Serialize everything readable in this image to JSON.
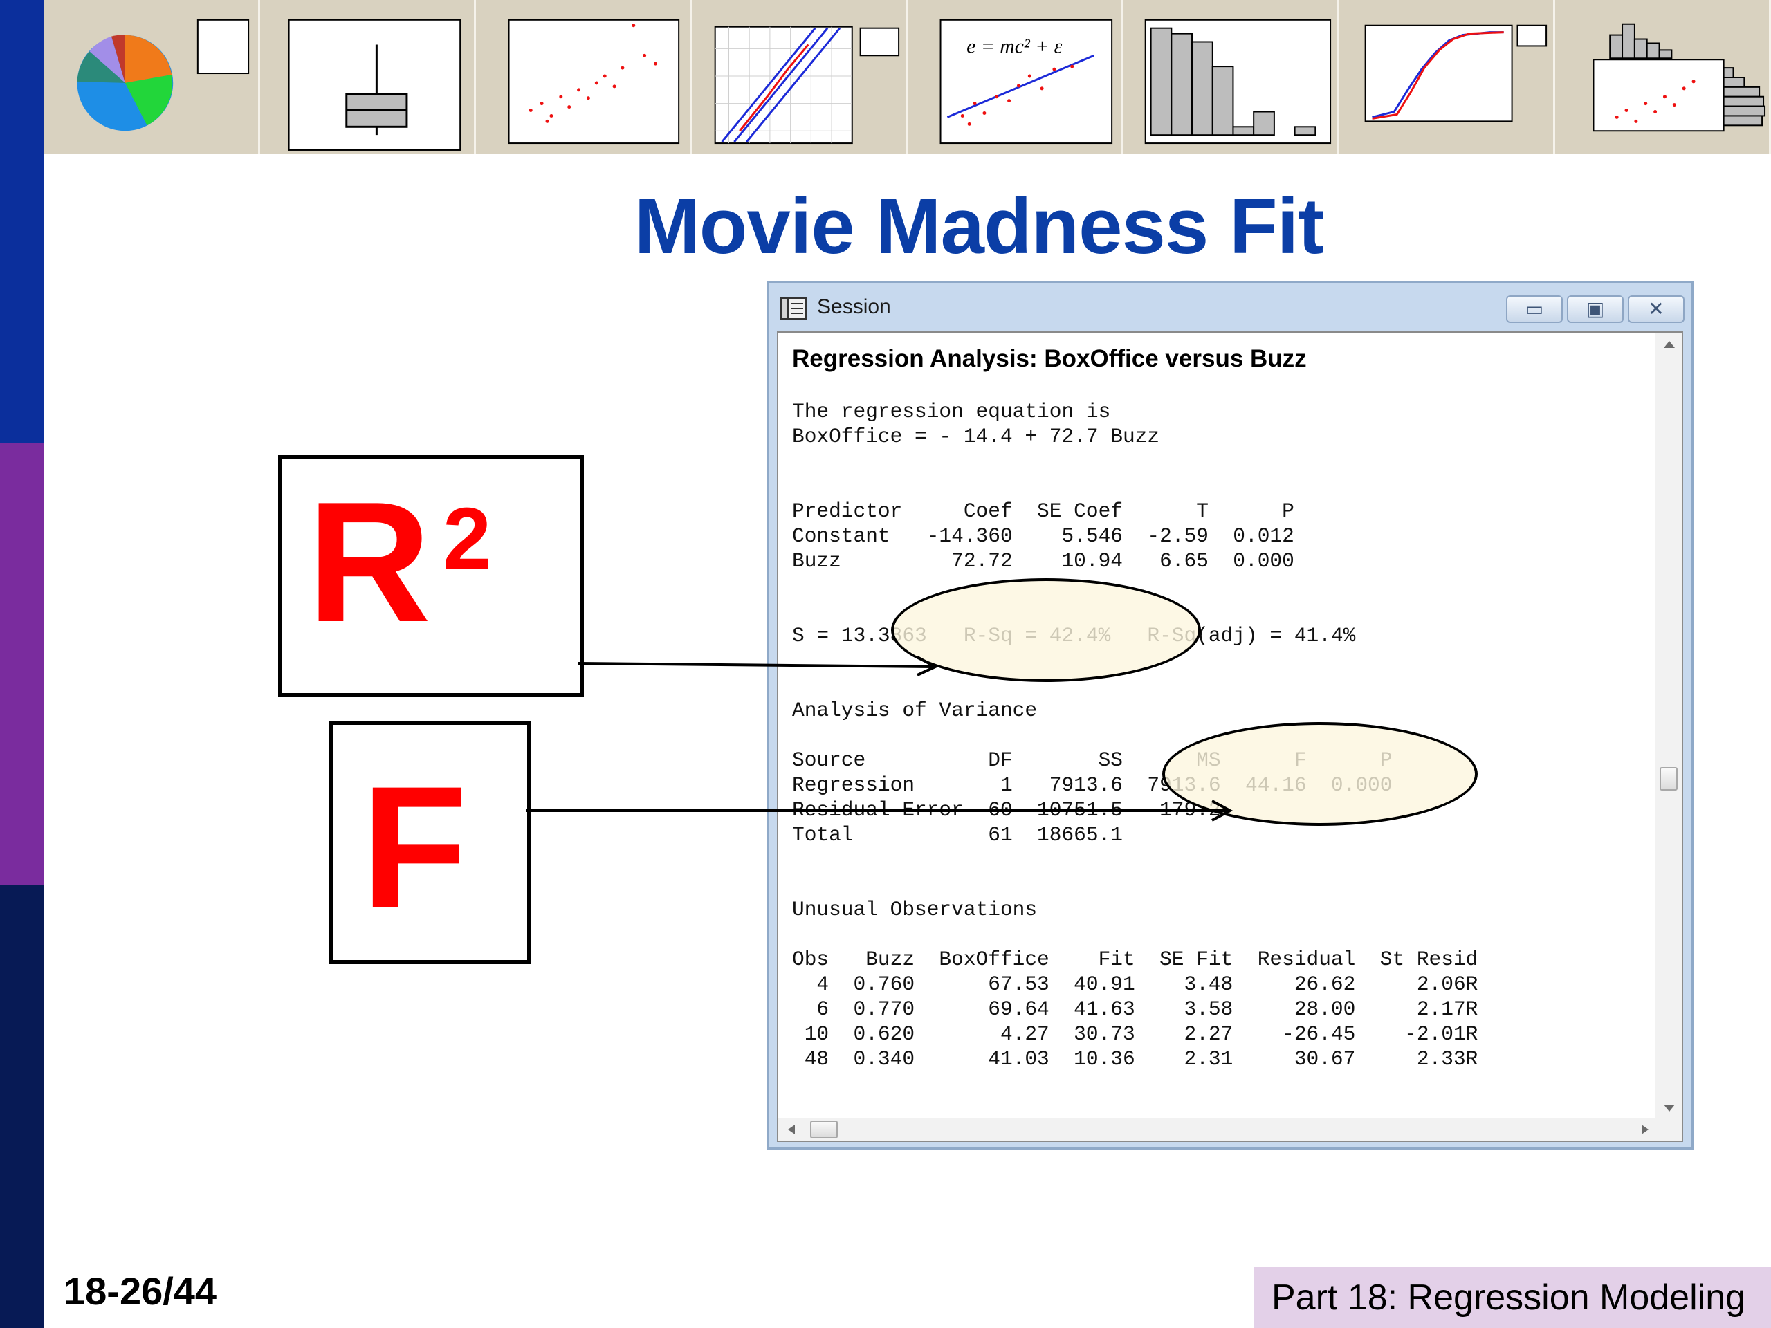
{
  "slide": {
    "title": "Movie Madness Fit",
    "slide_number": "18-26/44",
    "footer": "Part 18: Regression Modeling",
    "r_squared_label": "R",
    "r_squared_sup": "2",
    "f_label": "F",
    "colors": {
      "title": "#0b3ea6",
      "label_red": "#ff0000",
      "sidebar_top": "#0b2f9c",
      "sidebar_mid": "#7a2c9e",
      "sidebar_bottom": "#071a55",
      "footer_bg": "#e3d0e8",
      "highlight": "#fdf6de"
    }
  },
  "window": {
    "title": "Session",
    "icon": "session-icon",
    "buttons": [
      "minimize-icon",
      "maximize-icon",
      "close-icon"
    ],
    "minimize_glyph": "▭",
    "maximize_glyph": "▣",
    "close_glyph": "✕"
  },
  "regression": {
    "heading": "Regression Analysis: BoxOffice versus Buzz",
    "eq_line1": "The regression equation is",
    "eq_line2": "BoxOffice = - 14.4 + 72.7 Buzz",
    "coef_header": "Predictor     Coef  SE Coef      T      P",
    "coef_rows": [
      "Constant   -14.360    5.546  -2.59  0.012",
      "Buzz         72.72    10.94   6.65  0.000"
    ],
    "summary": "S = 13.3863   R-Sq = 42.4%   R-Sq(adj) = 41.4%",
    "anova_title": "Analysis of Variance",
    "anova_header": "Source          DF       SS      MS      F      P",
    "anova_rows": [
      "Regression       1   7913.6  7913.6  44.16  0.000",
      "Residual Error  60  10751.5   179.2",
      "Total           61  18665.1"
    ],
    "unusual_title": "Unusual Observations",
    "unusual_header": "Obs   Buzz  BoxOffice    Fit  SE Fit  Residual  St Resid",
    "unusual_rows": [
      "  4  0.760      67.53  40.91    3.48     26.62     2.06R",
      "  6  0.770      69.64  41.63    3.58     28.00     2.17R",
      " 10  0.620       4.27  30.73    2.27    -26.45    -2.01R",
      " 48  0.340      41.03  10.36    2.31     30.67     2.33R"
    ]
  },
  "thumbnails": {
    "equation": "e = mc² + ε",
    "items": [
      "pie-chart-icon",
      "boxplot-icon",
      "scatterplot-icon",
      "probability-plot-icon",
      "scatterplot-fit-icon",
      "histogram-icon",
      "ecdf-plot-icon",
      "marginal-plot-icon"
    ]
  }
}
